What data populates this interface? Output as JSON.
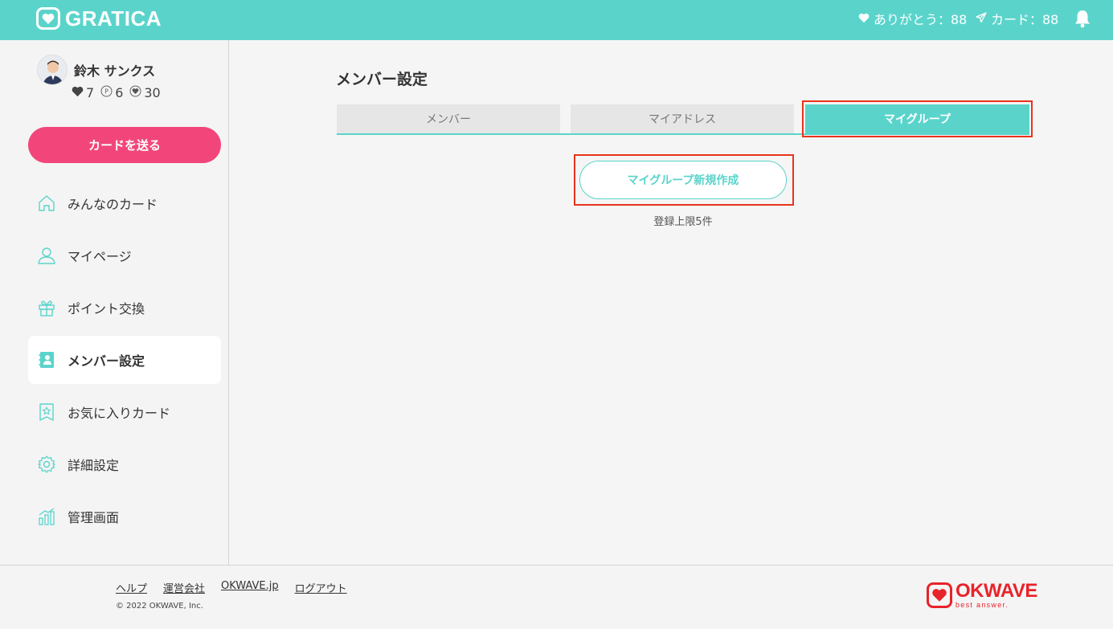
{
  "header": {
    "logo_text": "GRATICA",
    "thanks_text": "ありがとう：88",
    "cards_text": "カード：88"
  },
  "user": {
    "name": "鈴木 サンクス",
    "stats": [
      {
        "icon": "heart",
        "value": "7"
      },
      {
        "icon": "point",
        "value": "6"
      },
      {
        "icon": "heart-badge",
        "value": "30"
      }
    ]
  },
  "sidebar": {
    "send_button": "カードを送る",
    "items": [
      {
        "label": "みんなのカード",
        "icon": "home-icon"
      },
      {
        "label": "マイページ",
        "icon": "person-icon"
      },
      {
        "label": "ポイント交換",
        "icon": "gift-icon"
      },
      {
        "label": "メンバー設定",
        "icon": "address-book-icon",
        "active": true
      },
      {
        "label": "お気に入りカード",
        "icon": "bookmark-star-icon"
      },
      {
        "label": "詳細設定",
        "icon": "gear-icon"
      },
      {
        "label": "管理画面",
        "icon": "chart-icon"
      }
    ]
  },
  "main": {
    "title": "メンバー設定",
    "tabs": [
      {
        "label": "メンバー"
      },
      {
        "label": "マイアドレス"
      },
      {
        "label": "マイグループ",
        "active": true
      }
    ],
    "new_group_button": "マイグループ新規作成",
    "limit_text": "登録上限5件"
  },
  "footer": {
    "links": [
      "ヘルプ",
      "運営会社",
      "OKWAVE.jp",
      "ログアウト"
    ],
    "copyright": "© 2022 OKWAVE, Inc.",
    "brand": "OKWAVE",
    "brand_tagline": "best answer."
  },
  "colors": {
    "accent": "#5ad4cb",
    "send_button": "#f2467a",
    "highlight": "#e8341c",
    "okwave": "#e8232a"
  }
}
